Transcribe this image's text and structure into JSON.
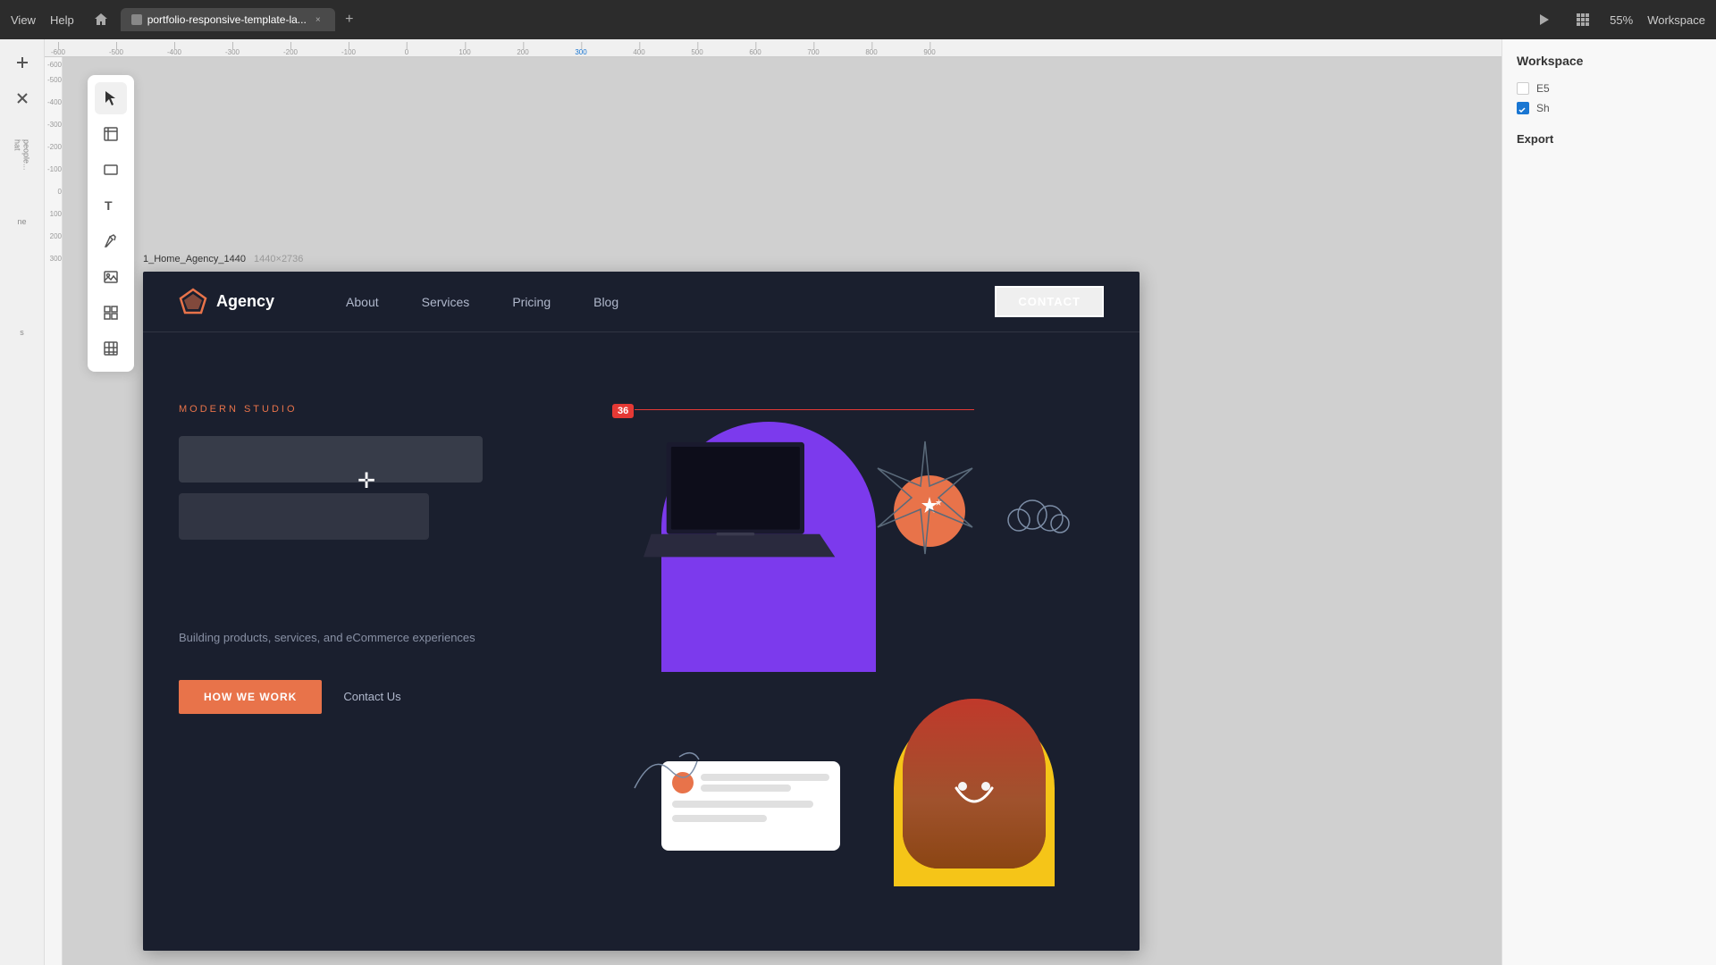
{
  "topbar": {
    "left_menu": [
      "View",
      "Help"
    ],
    "home_label": "home",
    "tab_name": "portfolio-responsive-template-la...",
    "tab_close": "×",
    "tab_add": "+",
    "play_label": "play",
    "grid_label": "grid",
    "zoom": "55%",
    "workspace_label": "Workspace"
  },
  "right_panel": {
    "title": "Worksp",
    "e5_label": "E5",
    "sh_label": "Sh",
    "export_label": "Export"
  },
  "frame": {
    "name": "1_Home_Agency_1440",
    "size": "1440×2736"
  },
  "selection": {
    "number": "36"
  },
  "site": {
    "logo_text": "Agency",
    "nav": {
      "about": "About",
      "services": "Services",
      "pricing": "Pricing",
      "blog": "Blog",
      "contact": "CONTACT"
    },
    "hero": {
      "subtitle": "MODERN STUDIO",
      "description": "Building products, services, and eCommerce experiences",
      "cta_primary": "HOW WE WORK",
      "cta_secondary": "Contact Us"
    }
  }
}
